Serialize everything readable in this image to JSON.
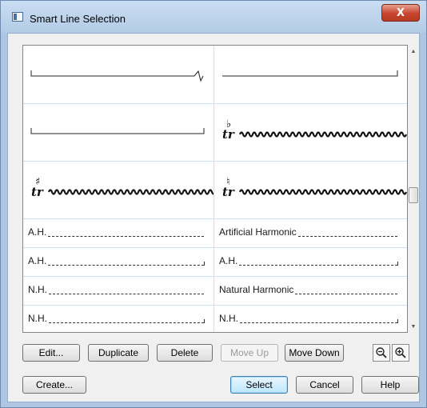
{
  "window": {
    "title": "Smart Line Selection",
    "close_label": "X"
  },
  "list": {
    "rows": [
      {
        "left": {
          "kind": "bracket-cut",
          "text": ""
        },
        "right": {
          "kind": "bracket-right",
          "text": ""
        }
      },
      {
        "left": {
          "kind": "bracket-both",
          "text": ""
        },
        "right": {
          "kind": "trill",
          "accidental": "♭",
          "text": ""
        }
      },
      {
        "left": {
          "kind": "trill",
          "accidental": "♯",
          "text": ""
        },
        "right": {
          "kind": "trill",
          "accidental": "♮",
          "text": ""
        }
      },
      {
        "left": {
          "kind": "dash",
          "text": "A.H."
        },
        "right": {
          "kind": "dash",
          "text": "Artificial Harmonic"
        }
      },
      {
        "left": {
          "kind": "dash-hook",
          "text": "A.H."
        },
        "right": {
          "kind": "dash-hook",
          "text": "A.H."
        }
      },
      {
        "left": {
          "kind": "dash",
          "text": "N.H."
        },
        "right": {
          "kind": "dash",
          "text": "Natural Harmonic"
        }
      },
      {
        "left": {
          "kind": "dash-hook",
          "text": "N.H."
        },
        "right": {
          "kind": "dash-hook",
          "text": "N.H."
        }
      }
    ],
    "trill_symbol": "tr"
  },
  "buttons": {
    "edit": "Edit...",
    "duplicate": "Duplicate",
    "delete": "Delete",
    "move_up": "Move Up",
    "move_down": "Move Down",
    "create": "Create...",
    "select": "Select",
    "cancel": "Cancel",
    "help": "Help"
  },
  "icons": {
    "zoom_out": "zoom-out-icon",
    "zoom_in": "zoom-in-icon"
  },
  "colors": {
    "close": "#c8442f",
    "default_button_border": "#3c7fb1"
  }
}
